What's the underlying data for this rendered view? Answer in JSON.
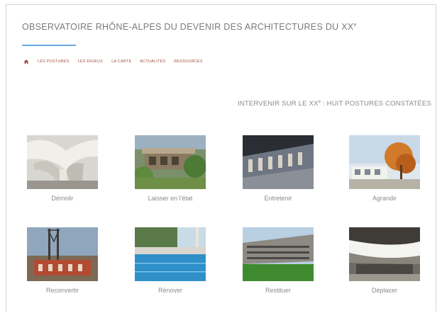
{
  "site": {
    "title_main": "OBSERVATOIRE RHÔNE-ALPES DU DEVENIR DES ARCHITECTURES DU XX",
    "title_sup": "e"
  },
  "nav": {
    "items": [
      {
        "label": "LES POSTURES"
      },
      {
        "label": "LES ENJEUX"
      },
      {
        "label": "LA CARTE"
      },
      {
        "label": "ACTUALITÉS"
      },
      {
        "label": "RESSOURCES"
      }
    ]
  },
  "heading": {
    "pre": "INTERVENIR SUR LE XX",
    "sup": "e",
    "post": " : HUIT POSTURES CONSTATÉES"
  },
  "postures": [
    {
      "label": "Démolir"
    },
    {
      "label": "Laisser en l'état"
    },
    {
      "label": "Entretenir"
    },
    {
      "label": "Agrandir"
    },
    {
      "label": "Reconvertir"
    },
    {
      "label": "Rénover"
    },
    {
      "label": "Restituer"
    },
    {
      "label": "Déplacer"
    }
  ],
  "colors": {
    "accent": "#6aa8e0",
    "nav_text": "#a0503d",
    "title_text": "#7a7a7a"
  }
}
